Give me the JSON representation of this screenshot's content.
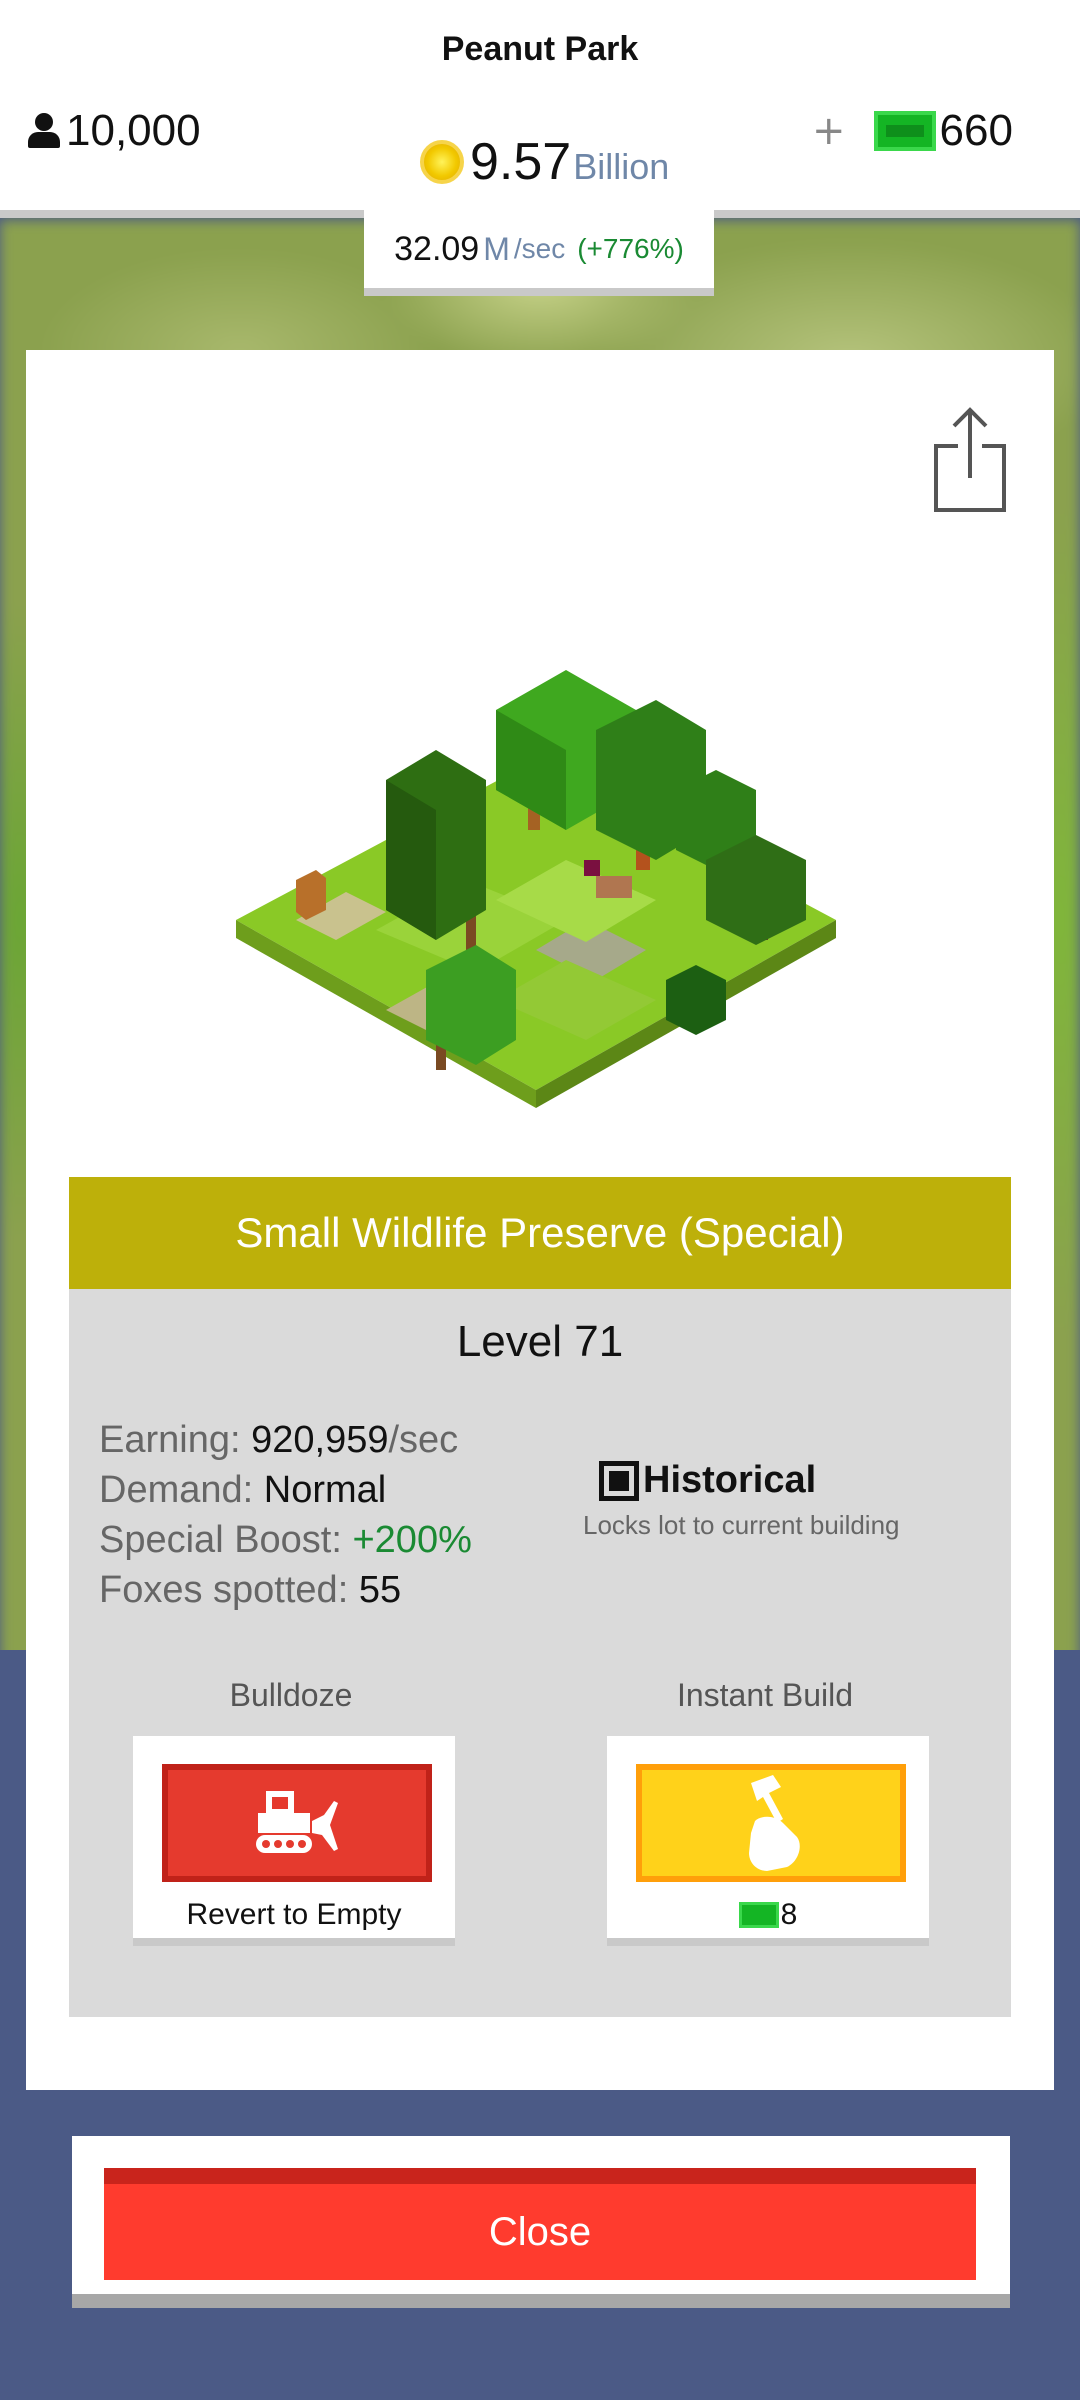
{
  "hud": {
    "park_name": "Peanut Park",
    "population": "10,000",
    "money_value": "9.57",
    "money_unit": "Billion",
    "premium_plus": "+",
    "premium_cash": "660",
    "rate_value": "32.09",
    "rate_unit": "M",
    "rate_per": "/sec",
    "rate_change": "(+776%)"
  },
  "building": {
    "name": "Small Wildlife Preserve (Special)",
    "level": "Level 71",
    "stats": {
      "earning_label": "Earning:",
      "earning_value": "920,959",
      "earning_unit": "/sec",
      "demand_label": "Demand:",
      "demand_value": "Normal",
      "boost_label": "Special Boost:",
      "boost_value": "+200%",
      "foxes_label": "Foxes spotted:",
      "foxes_value": "55"
    },
    "historical": {
      "label": "Historical",
      "description": "Locks lot to current building",
      "checked": true
    }
  },
  "actions": {
    "bulldoze_label": "Bulldoze",
    "bulldoze_caption": "Revert to Empty",
    "instant_build_label": "Instant Build",
    "instant_build_cost": "8"
  },
  "close_label": "Close",
  "colors": {
    "title_bar": "#bdb00a",
    "bulldoze": "#e53a2e",
    "instant_build": "#ffd21a",
    "close": "#ff3b2e",
    "boost_green": "#1a8a33",
    "background": "#4b5a86"
  },
  "icons": [
    "person-icon",
    "coin-icon",
    "plus-icon",
    "cash-icon",
    "share-icon",
    "checkbox-icon",
    "bulldozer-icon",
    "hammer-hand-icon"
  ]
}
